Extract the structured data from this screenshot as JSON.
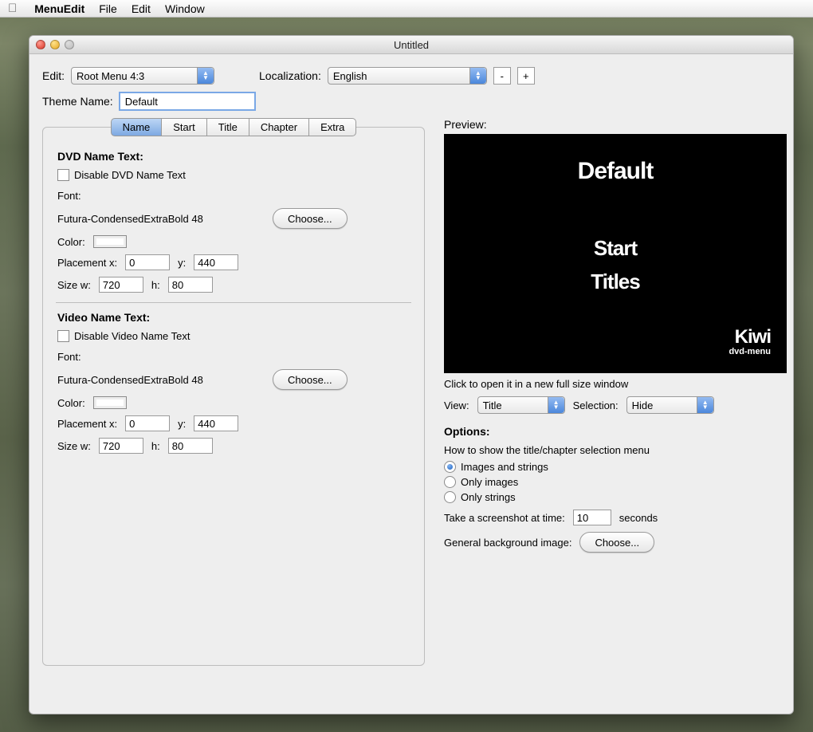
{
  "menubar": {
    "appname": "MenuEdit",
    "items": [
      "File",
      "Edit",
      "Window"
    ]
  },
  "window": {
    "title": "Untitled"
  },
  "top": {
    "edit_label": "Edit:",
    "edit_value": "Root Menu 4:3",
    "loc_label": "Localization:",
    "loc_value": "English",
    "minus": "-",
    "plus": "+",
    "theme_label": "Theme Name:",
    "theme_value": "Default"
  },
  "tabs": [
    "Name",
    "Start",
    "Title",
    "Chapter",
    "Extra"
  ],
  "tabs_selected_index": 0,
  "namePanel": {
    "dvd": {
      "heading": "DVD Name Text:",
      "disable_label": "Disable DVD Name Text",
      "font_label": "Font:",
      "font_value": "Futura-CondensedExtraBold 48",
      "choose": "Choose...",
      "color_label": "Color:",
      "px_label": "Placement x:",
      "px": "0",
      "py_label": "y:",
      "py": "440",
      "sw_label": "Size w:",
      "sw": "720",
      "sh_label": "h:",
      "sh": "80"
    },
    "video": {
      "heading": "Video Name Text:",
      "disable_label": "Disable Video Name Text",
      "font_label": "Font:",
      "font_value": "Futura-CondensedExtraBold 48",
      "choose": "Choose...",
      "color_label": "Color:",
      "px_label": "Placement x:",
      "px": "0",
      "py_label": "y:",
      "py": "440",
      "sw_label": "Size w:",
      "sw": "720",
      "sh_label": "h:",
      "sh": "80"
    }
  },
  "preview": {
    "label": "Preview:",
    "default": "Default",
    "start": "Start",
    "titles": "Titles",
    "kiwi": "Kiwi",
    "kiwi_sub": "dvd-menu",
    "hint": "Click to open it in a new full size window",
    "view_label": "View:",
    "view_value": "Title",
    "selection_label": "Selection:",
    "selection_value": "Hide"
  },
  "options": {
    "heading": "Options:",
    "howto": "How to show the title/chapter selection menu",
    "radios": [
      "Images and strings",
      "Only images",
      "Only strings"
    ],
    "radio_selected_index": 0,
    "screenshot_label_pre": "Take a screenshot at time:",
    "screenshot_value": "10",
    "screenshot_label_post": "seconds",
    "bg_label": "General background image:",
    "bg_choose": "Choose..."
  }
}
